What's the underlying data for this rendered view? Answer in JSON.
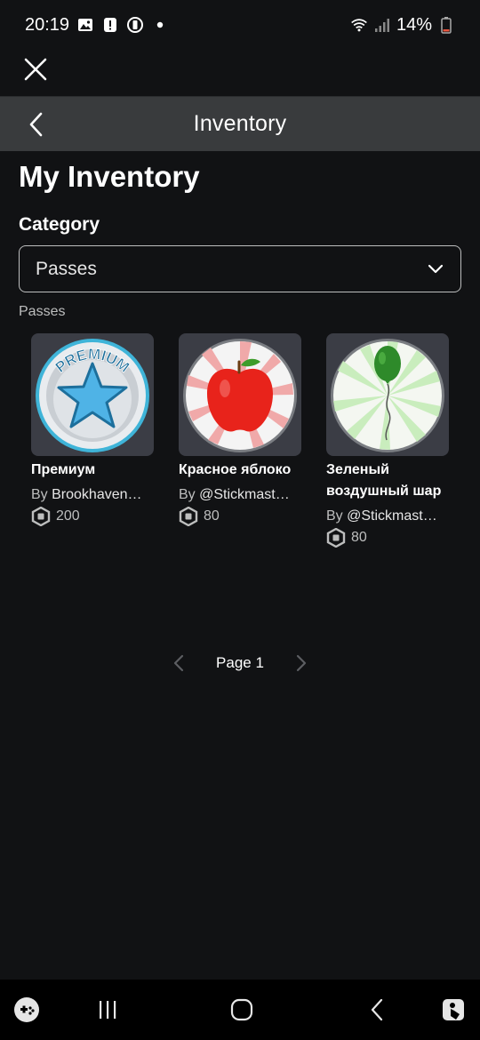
{
  "status_bar": {
    "time": "20:19",
    "battery": "14%"
  },
  "header": {
    "title": "Inventory"
  },
  "page": {
    "title": "My Inventory",
    "category_label": "Category",
    "category_value": "Passes",
    "section_label": "Passes"
  },
  "items": [
    {
      "name": "Премиум",
      "by": "By ",
      "creator": "Brookhaven…",
      "price": "200",
      "icon": "premium-star-badge"
    },
    {
      "name": "Красное яблоко",
      "by": "By ",
      "creator": "@Stickmast…",
      "price": "80",
      "icon": "red-apple"
    },
    {
      "name": "Зеленый воздушный шар",
      "by": "By ",
      "creator": "@Stickmast…",
      "price": "80",
      "icon": "green-balloon"
    }
  ],
  "pagination": {
    "label": "Page 1"
  },
  "colors": {
    "background": "#111214",
    "header_bg": "#393b3d",
    "thumb_bg": "#3b3d45",
    "muted_text": "#bdbebe"
  }
}
